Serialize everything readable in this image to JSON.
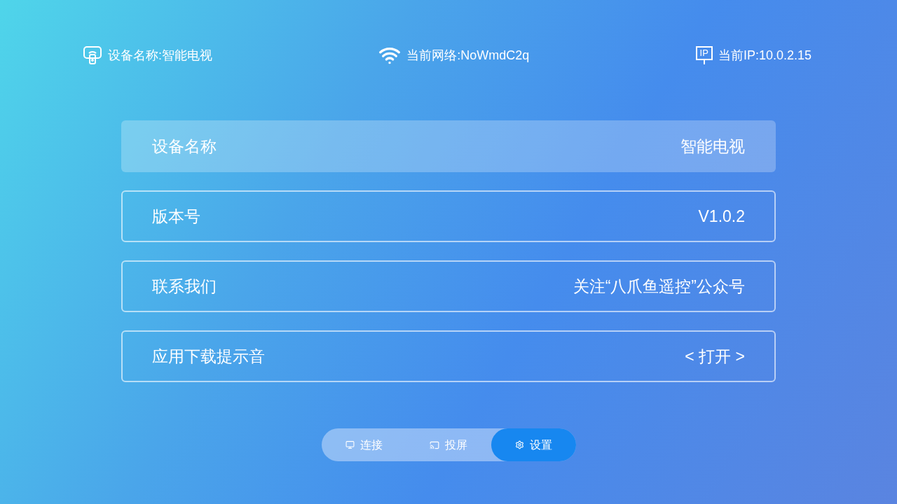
{
  "status_bar": [
    {
      "kind": "device",
      "label": "设备名称:智能电视"
    },
    {
      "kind": "wifi",
      "label": "当前网络:NoWmdC2q"
    },
    {
      "kind": "ip",
      "badge": "IP",
      "label": "当前IP:10.0.2.15"
    }
  ],
  "settings": [
    {
      "label": "设备名称",
      "value": "智能电视",
      "selected": true
    },
    {
      "label": "版本号",
      "value": "V1.0.2",
      "selected": false
    },
    {
      "label": "联系我们",
      "value": "关注“八爪鱼遥控”公众号",
      "selected": false
    },
    {
      "label": "应用下载提示音",
      "value": "< 打开 >",
      "selected": false
    }
  ],
  "tabs": [
    {
      "kind": "connect",
      "label": "连接",
      "selected": false
    },
    {
      "kind": "cast",
      "label": "投屏",
      "selected": false
    },
    {
      "kind": "settings",
      "label": "设置",
      "selected": true
    }
  ]
}
